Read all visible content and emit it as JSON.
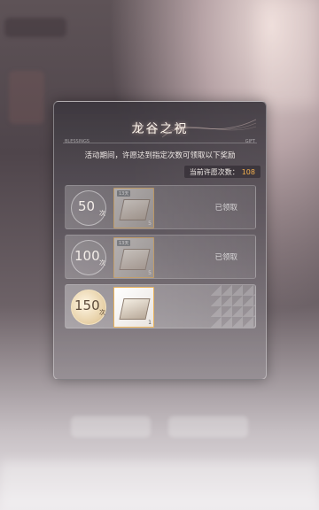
{
  "panel": {
    "title": "龙谷之祝",
    "small_left": "BLESSINGS",
    "small_right": "GIFT",
    "description": "活动期间，许愿达到指定次数可领取以下奖励",
    "count_label": "当前许愿次数：",
    "count_value": "108"
  },
  "rewards": [
    {
      "count": "50",
      "unit": "次",
      "item_tag": "13天",
      "quantity": "5",
      "status": "已领取"
    },
    {
      "count": "100",
      "unit": "次",
      "item_tag": "13天",
      "quantity": "5",
      "status": "已领取"
    },
    {
      "count": "150",
      "unit": "次",
      "item_tag": "",
      "quantity": "1",
      "status": ""
    }
  ],
  "colors": {
    "accent": "#f5b14d",
    "item_border": "#e9b35c"
  }
}
